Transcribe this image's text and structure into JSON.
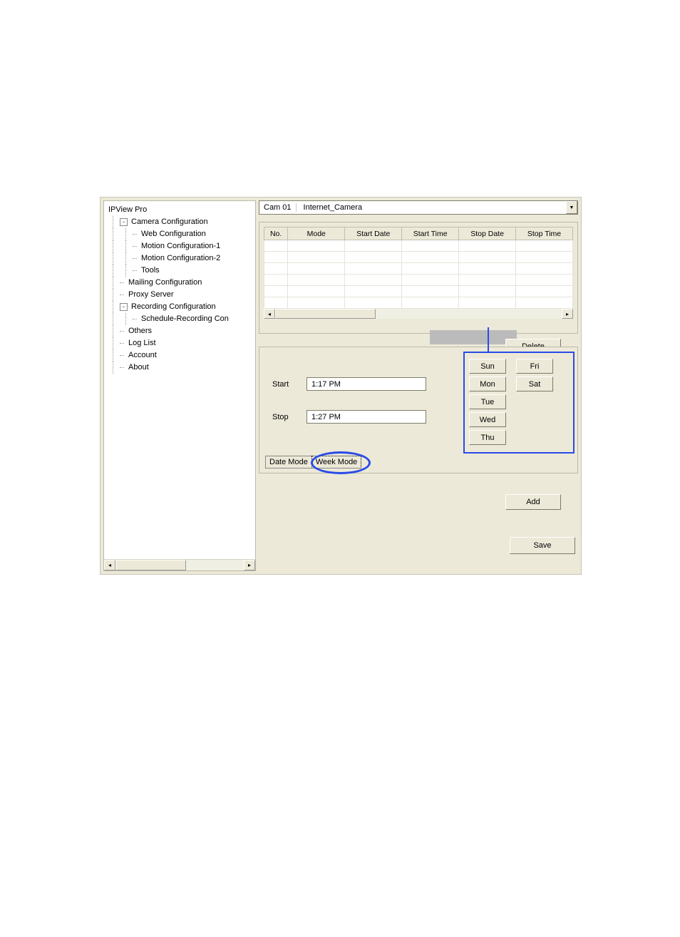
{
  "tree": {
    "root": "IPView Pro",
    "camera_cfg": "Camera Configuration",
    "web_cfg": "Web Configuration",
    "motion1": "Motion Configuration-1",
    "motion2": "Motion Configuration-2",
    "tools": "Tools",
    "mailing": "Mailing Configuration",
    "proxy": "Proxy Server",
    "recording_cfg": "Recording Configuration",
    "schedule_rec": "Schedule-Recording Con",
    "others": "Others",
    "loglist": "Log List",
    "account": "Account",
    "about": "About"
  },
  "combo": {
    "cam_label": "Cam 01",
    "cam_name": "Internet_Camera"
  },
  "grid_headers": {
    "no": "No.",
    "mode": "Mode",
    "start_date": "Start Date",
    "start_time": "Start Time",
    "stop_date": "Stop Date",
    "stop_time": "Stop Time"
  },
  "buttons": {
    "delete": "Delete",
    "add": "Add",
    "save": "Save",
    "date_mode": "Date Mode",
    "week_mode": "Week Mode"
  },
  "fields": {
    "start_label": "Start",
    "start_value": "1:17 PM",
    "stop_label": "Stop",
    "stop_value": "1:27 PM"
  },
  "days": {
    "sun": "Sun",
    "mon": "Mon",
    "tue": "Tue",
    "wed": "Wed",
    "thu": "Thu",
    "fri": "Fri",
    "sat": "Sat"
  }
}
